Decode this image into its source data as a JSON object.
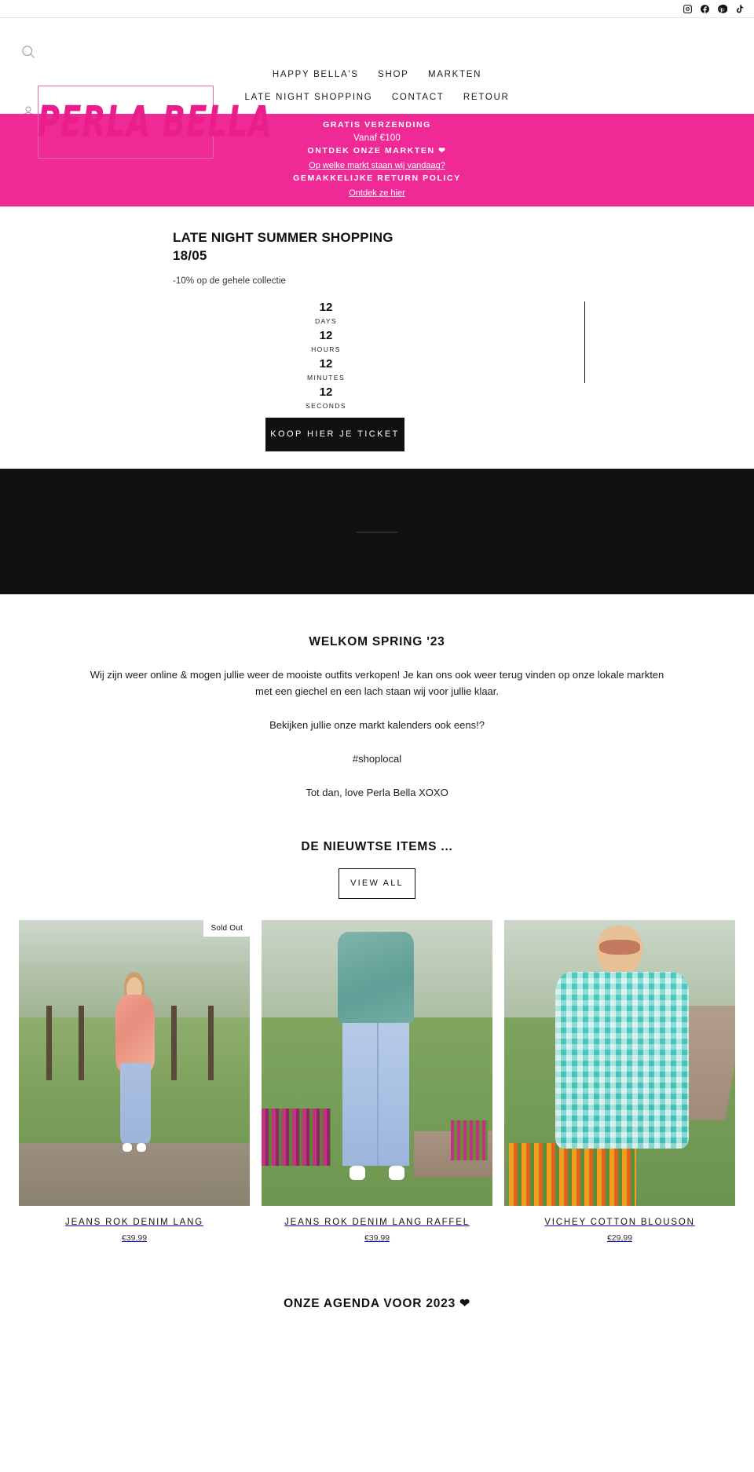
{
  "brand": {
    "logo_text": "PERLA BELLA"
  },
  "social": [
    {
      "name": "instagram-icon",
      "label": "Instagram"
    },
    {
      "name": "facebook-icon",
      "label": "Facebook"
    },
    {
      "name": "pinterest-icon",
      "label": "Pinterest"
    },
    {
      "name": "tiktok-icon",
      "label": "TikTok"
    }
  ],
  "header": {
    "search_icon": "search-icon",
    "account_icon": "account-icon",
    "nav_row1": [
      {
        "label": "HAPPY BELLA'S"
      },
      {
        "label": "SHOP"
      },
      {
        "label": "MARKTEN"
      }
    ],
    "nav_row2": [
      {
        "label": "LATE NIGHT SHOPPING"
      },
      {
        "label": "CONTACT"
      },
      {
        "label": "RETOUR"
      }
    ]
  },
  "announcement": {
    "line1": "GRATIS VERZENDING",
    "line2": "Vanaf €100",
    "line3": "ONTDEK ONZE MARKTEN ❤",
    "line4": "Op welke markt staan wij vandaag?",
    "line5": "GEMAKKELIJKE RETURN POLICY",
    "line6": "Ontdek ze hier",
    "background": "#ef2a96"
  },
  "promo": {
    "title": "LATE NIGHT SUMMER SHOPPING",
    "date": "18/05",
    "subtitle": "-10% op de gehele collectie",
    "countdown": [
      {
        "value": "12",
        "unit": "DAYS"
      },
      {
        "value": "12",
        "unit": "HOURS"
      },
      {
        "value": "12",
        "unit": "MINUTES"
      },
      {
        "value": "12",
        "unit": "SECONDS"
      }
    ],
    "cta_label": "KOOP HIER JE TICKET"
  },
  "welcome": {
    "heading": "WELKOM SPRING '23",
    "paragraph1": "Wij zijn weer online & mogen jullie weer de mooiste outfits verkopen! Je kan ons ook weer terug vinden op onze lokale markten met een giechel en een lach staan wij voor jullie klaar.",
    "paragraph2": "Bekijken jullie onze markt kalenders ook eens!?",
    "paragraph3": "#shoplocal",
    "paragraph4": "Tot dan,   love Perla Bella XOXO"
  },
  "new_items": {
    "heading": "DE NIEUWTSE ITEMS ...",
    "view_all_label": "VIEW ALL",
    "products": [
      {
        "title": "JEANS ROK DENIM LANG",
        "price": "€39,99",
        "badge": "Sold Out"
      },
      {
        "title": "JEANS ROK DENIM LANG RAFFEL",
        "price": "€39,99",
        "badge": ""
      },
      {
        "title": "VICHEY COTTON BLOUSON",
        "price": "€29,99",
        "badge": ""
      }
    ]
  },
  "agenda": {
    "heading": "ONZE AGENDA VOOR 2023 ❤"
  }
}
